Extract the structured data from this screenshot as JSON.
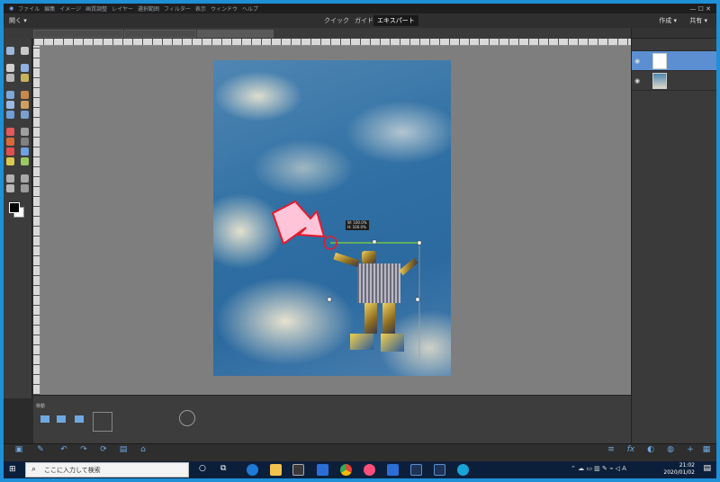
{
  "menubar": {
    "items": [
      "ファイル",
      "編集",
      "イメージ",
      "画質調整",
      "レイヤー",
      "選択範囲",
      "フィルター",
      "表示",
      "ウィンドウ",
      "ヘルプ"
    ]
  },
  "modebar": {
    "open": "開く",
    "tabs": [
      "クイック",
      "ガイド",
      "エキスパート"
    ],
    "create": "作成",
    "share": "共有"
  },
  "tool_options": {
    "title": "移動"
  },
  "transform_tip": {
    "line1": "W: 100.0%",
    "line2": "H: 100.0%"
  },
  "taskbar": {
    "search_placeholder": "ここに入力して検索",
    "time": "21:02",
    "date": "2020/01/02"
  },
  "colors": {
    "accent": "#5b8fd1",
    "arrow_fill": "#ffc4d8",
    "arrow_stroke": "#e8192c",
    "guide": "#7fd63c",
    "desktop": "#1f8fd6"
  }
}
